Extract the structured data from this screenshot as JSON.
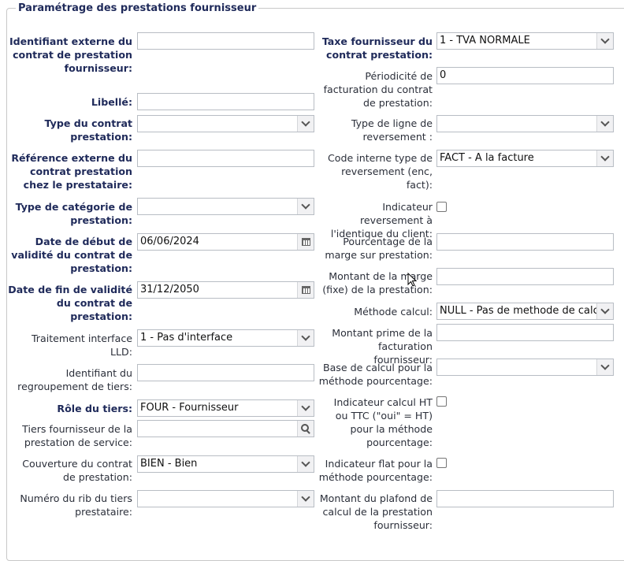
{
  "fieldset": {
    "legend": "Paramétrage des prestations fournisseur"
  },
  "left": {
    "identifiant_externe": {
      "label": "Identifiant externe du contrat de prestation fournisseur:",
      "value": ""
    },
    "libelle": {
      "label": "Libellé:",
      "value": ""
    },
    "type_contrat": {
      "label": "Type du contrat prestation:",
      "value": ""
    },
    "reference_externe": {
      "label": "Référence externe du contrat prestation chez le prestataire:",
      "value": ""
    },
    "type_categorie": {
      "label": "Type de catégorie de prestation:",
      "value": ""
    },
    "date_debut": {
      "label": "Date de début de validité du contrat de prestation:",
      "value": "06/06/2024"
    },
    "date_fin": {
      "label": "Date de fin de validité du contrat de prestation:",
      "value": "31/12/2050"
    },
    "traitement_interface": {
      "label": "Traitement interface LLD:",
      "value": "1 - Pas d'interface"
    },
    "identifiant_regroupement": {
      "label": "Identifiant du regroupement de tiers:",
      "value": ""
    },
    "role_tiers": {
      "label": "Rôle du tiers:",
      "value": "FOUR - Fournisseur"
    },
    "tiers_fournisseur": {
      "label": "Tiers fournisseur de la prestation de service:",
      "value": ""
    },
    "couverture": {
      "label": "Couverture du contrat de prestation:",
      "value": "BIEN - Bien"
    },
    "numero_rib": {
      "label": "Numéro du rib du tiers prestataire:",
      "value": ""
    }
  },
  "right": {
    "taxe_fournisseur": {
      "label": "Taxe fournisseur du contrat prestation:",
      "value": "1 - TVA NORMALE"
    },
    "periodicite": {
      "label": "Périodicité de facturation du contrat de prestation:",
      "value": "0"
    },
    "type_ligne": {
      "label": "Type de ligne de reversement :",
      "value": ""
    },
    "code_interne": {
      "label": "Code interne type de reversement (enc, fact):",
      "value": "FACT - A la facture"
    },
    "indicateur_reversement": {
      "label": "Indicateur reversement à l'identique du client:",
      "checked": false
    },
    "pourcentage_marge": {
      "label": "Pourcentage de la marge sur prestation:",
      "value": ""
    },
    "montant_marge": {
      "label": "Montant de la marge (fixe) de la prestation:",
      "value": ""
    },
    "methode_calcul": {
      "label": "Méthode calcul:",
      "value": "NULL - Pas de methode de calcul"
    },
    "montant_prime": {
      "label": "Montant prime de la facturation fournisseur:",
      "value": ""
    },
    "base_calcul": {
      "label": "Base de calcul pour la méthode pourcentage:",
      "value": ""
    },
    "indicateur_ht_ttc": {
      "label": "Indicateur calcul HT ou TTC (\"oui\" = HT) pour la méthode pourcentage:",
      "checked": false
    },
    "indicateur_flat": {
      "label": "Indicateur flat pour la méthode pourcentage:",
      "checked": false
    },
    "montant_plafond": {
      "label": "Montant du plafond de calcul de la prestation fournisseur:",
      "value": ""
    }
  }
}
